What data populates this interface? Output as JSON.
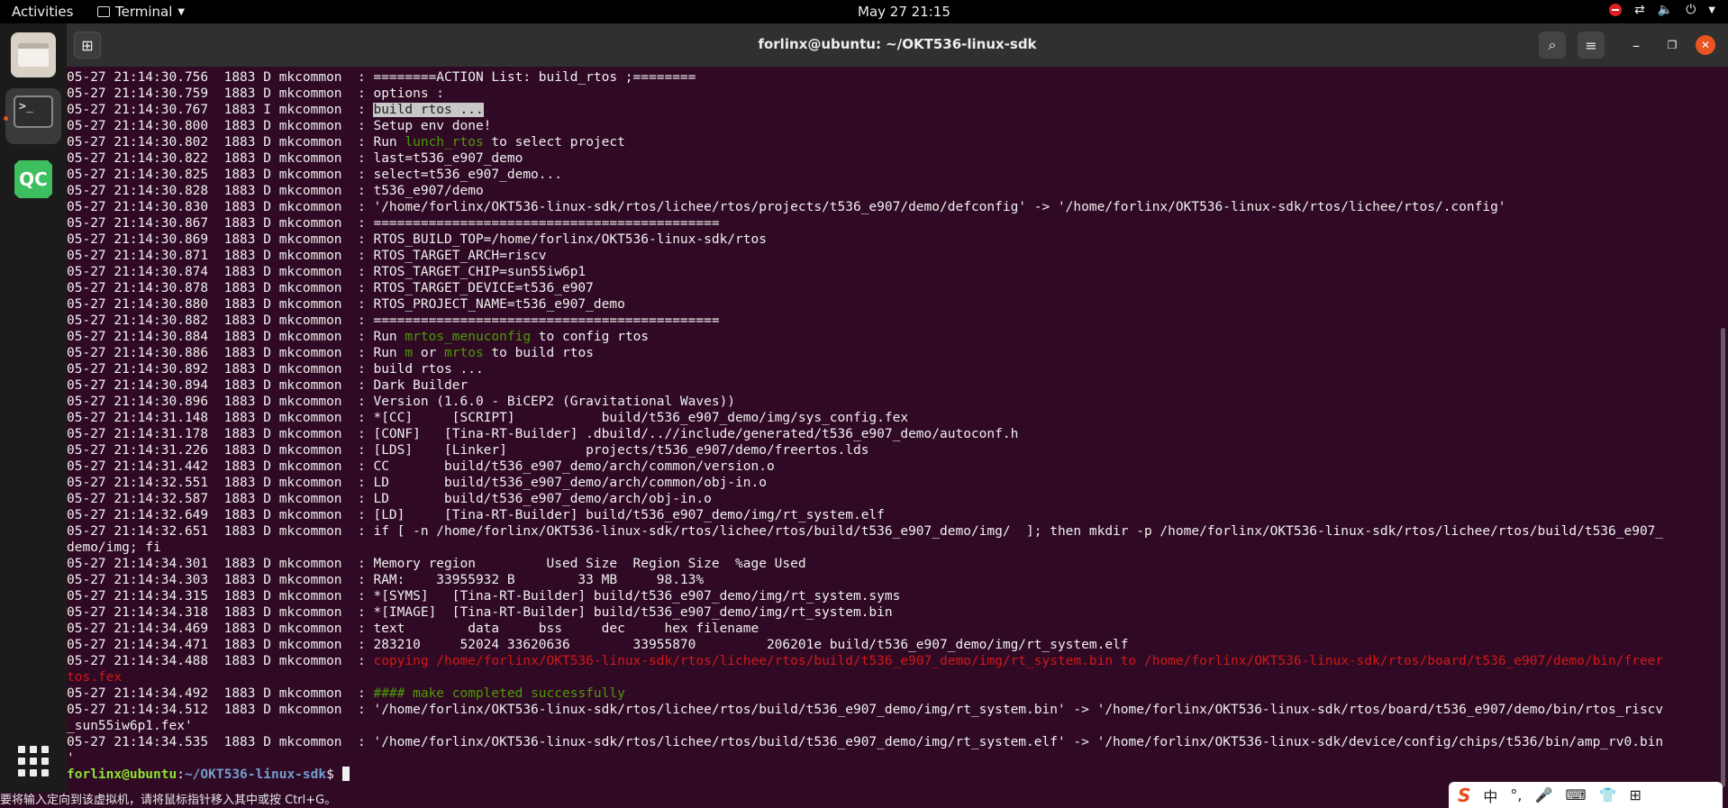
{
  "topbar": {
    "activities": "Activities",
    "app_name": "Terminal",
    "clock": "May 27  21:15"
  },
  "window": {
    "title": "forlinx@ubuntu: ~/OKT536-linux-sdk"
  },
  "terminal": {
    "lines": [
      [
        {
          "t": "05-27 21:14:30.756  1883 D mkcommon  : ========ACTION List: build_rtos ;========"
        }
      ],
      [
        {
          "t": "05-27 21:14:30.759  1883 D mkcommon  : options :"
        }
      ],
      [
        {
          "t": "05-27 21:14:30.767  1883 I mkcommon  : "
        },
        {
          "t": "build rtos ...",
          "c": "hl"
        }
      ],
      [
        {
          "t": "05-27 21:14:30.800  1883 D mkcommon  : Setup env done!"
        }
      ],
      [
        {
          "t": "05-27 21:14:30.802  1883 D mkcommon  : Run "
        },
        {
          "t": "lunch_rtos",
          "c": "grn"
        },
        {
          "t": " to select project"
        }
      ],
      [
        {
          "t": "05-27 21:14:30.822  1883 D mkcommon  : last=t536_e907_demo"
        }
      ],
      [
        {
          "t": "05-27 21:14:30.825  1883 D mkcommon  : select=t536_e907_demo..."
        }
      ],
      [
        {
          "t": "05-27 21:14:30.828  1883 D mkcommon  : t536_e907/demo"
        }
      ],
      [
        {
          "t": "05-27 21:14:30.830  1883 D mkcommon  : '/home/forlinx/OKT536-linux-sdk/rtos/lichee/rtos/projects/t536_e907/demo/defconfig' -> '/home/forlinx/OKT536-linux-sdk/rtos/lichee/rtos/.config'"
        }
      ],
      [
        {
          "t": "05-27 21:14:30.867  1883 D mkcommon  : ============================================"
        }
      ],
      [
        {
          "t": "05-27 21:14:30.869  1883 D mkcommon  : RTOS_BUILD_TOP=/home/forlinx/OKT536-linux-sdk/rtos"
        }
      ],
      [
        {
          "t": "05-27 21:14:30.871  1883 D mkcommon  : RTOS_TARGET_ARCH=riscv"
        }
      ],
      [
        {
          "t": "05-27 21:14:30.874  1883 D mkcommon  : RTOS_TARGET_CHIP=sun55iw6p1"
        }
      ],
      [
        {
          "t": "05-27 21:14:30.878  1883 D mkcommon  : RTOS_TARGET_DEVICE=t536_e907"
        }
      ],
      [
        {
          "t": "05-27 21:14:30.880  1883 D mkcommon  : RTOS_PROJECT_NAME=t536_e907_demo"
        }
      ],
      [
        {
          "t": "05-27 21:14:30.882  1883 D mkcommon  : ============================================"
        }
      ],
      [
        {
          "t": "05-27 21:14:30.884  1883 D mkcommon  : Run "
        },
        {
          "t": "mrtos_menuconfig",
          "c": "grn"
        },
        {
          "t": " to config rtos"
        }
      ],
      [
        {
          "t": "05-27 21:14:30.886  1883 D mkcommon  : Run "
        },
        {
          "t": "m",
          "c": "grn"
        },
        {
          "t": " or "
        },
        {
          "t": "mrtos",
          "c": "grn"
        },
        {
          "t": " to build rtos"
        }
      ],
      [
        {
          "t": "05-27 21:14:30.892  1883 D mkcommon  : build rtos ..."
        }
      ],
      [
        {
          "t": "05-27 21:14:30.894  1883 D mkcommon  : Dark Builder"
        }
      ],
      [
        {
          "t": "05-27 21:14:30.896  1883 D mkcommon  : Version (1.6.0 - BiCEP2 (Gravitational Waves))"
        }
      ],
      [
        {
          "t": "05-27 21:14:31.148  1883 D mkcommon  : *[CC]     [SCRIPT]           build/t536_e907_demo/img/sys_config.fex"
        }
      ],
      [
        {
          "t": "05-27 21:14:31.178  1883 D mkcommon  : [CONF]   [Tina-RT-Builder] .dbuild/..//include/generated/t536_e907_demo/autoconf.h"
        }
      ],
      [
        {
          "t": "05-27 21:14:31.226  1883 D mkcommon  : [LDS]    [Linker]          projects/t536_e907/demo/freertos.lds"
        }
      ],
      [
        {
          "t": "05-27 21:14:31.442  1883 D mkcommon  : CC       build/t536_e907_demo/arch/common/version.o"
        }
      ],
      [
        {
          "t": "05-27 21:14:32.551  1883 D mkcommon  : LD       build/t536_e907_demo/arch/common/obj-in.o"
        }
      ],
      [
        {
          "t": "05-27 21:14:32.587  1883 D mkcommon  : LD       build/t536_e907_demo/arch/obj-in.o"
        }
      ],
      [
        {
          "t": "05-27 21:14:32.649  1883 D mkcommon  : [LD]     [Tina-RT-Builder] build/t536_e907_demo/img/rt_system.elf"
        }
      ],
      [
        {
          "t": "05-27 21:14:32.651  1883 D mkcommon  : if [ -n /home/forlinx/OKT536-linux-sdk/rtos/lichee/rtos/build/t536_e907_demo/img/  ]; then mkdir -p /home/forlinx/OKT536-linux-sdk/rtos/lichee/rtos/build/t536_e907_"
        }
      ],
      [
        {
          "t": "demo/img; fi"
        }
      ],
      [
        {
          "t": "05-27 21:14:34.301  1883 D mkcommon  : Memory region         Used Size  Region Size  %age Used"
        }
      ],
      [
        {
          "t": "05-27 21:14:34.303  1883 D mkcommon  : RAM:    33955932 B        33 MB     98.13%"
        }
      ],
      [
        {
          "t": "05-27 21:14:34.315  1883 D mkcommon  : *[SYMS]   [Tina-RT-Builder] build/t536_e907_demo/img/rt_system.syms"
        }
      ],
      [
        {
          "t": "05-27 21:14:34.318  1883 D mkcommon  : *[IMAGE]  [Tina-RT-Builder] build/t536_e907_demo/img/rt_system.bin"
        }
      ],
      [
        {
          "t": "05-27 21:14:34.469  1883 D mkcommon  : text        data     bss     dec     hex filename"
        }
      ],
      [
        {
          "t": "05-27 21:14:34.471  1883 D mkcommon  : 283210     52024 33620636        33955870         206201e build/t536_e907_demo/img/rt_system.elf"
        }
      ],
      [
        {
          "t": "05-27 21:14:34.488  1883 D mkcommon  : "
        },
        {
          "t": "copying /home/forlinx/OKT536-linux-sdk/rtos/lichee/rtos/build/t536_e907_demo/img/rt_system.bin to /home/forlinx/OKT536-linux-sdk/rtos/board/t536_e907/demo/bin/freer",
          "c": "red"
        }
      ],
      [
        {
          "t": "tos.fex",
          "c": "red"
        }
      ],
      [
        {
          "t": "05-27 21:14:34.492  1883 D mkcommon  : "
        },
        {
          "t": "#### make completed successfully",
          "c": "grn"
        }
      ],
      [
        {
          "t": "05-27 21:14:34.512  1883 D mkcommon  : '/home/forlinx/OKT536-linux-sdk/rtos/lichee/rtos/build/t536_e907_demo/img/rt_system.bin' -> '/home/forlinx/OKT536-linux-sdk/rtos/board/t536_e907/demo/bin/rtos_riscv"
        }
      ],
      [
        {
          "t": "_sun55iw6p1.fex'"
        }
      ],
      [
        {
          "t": "05-27 21:14:34.535  1883 D mkcommon  : '/home/forlinx/OKT536-linux-sdk/rtos/lichee/rtos/build/t536_e907_demo/img/rt_system.elf' -> '/home/forlinx/OKT536-linux-sdk/device/config/chips/t536/bin/amp_rv0.bin"
        }
      ],
      [
        {
          "t": "'"
        }
      ]
    ],
    "prompt_user": "forlinx@ubuntu",
    "prompt_sep": ":",
    "prompt_path": "~/OKT536-linux-sdk",
    "prompt_suffix": "$ "
  },
  "notice": {
    "text": "要将输入定向到该虚拟机，请将鼠标指针移入其中或按 Ctrl+G。"
  },
  "ime": {
    "mode": "中",
    "punct": "°,"
  },
  "icons": [
    "folder-icon",
    "terminal-icon",
    "qt-creator-icon",
    "app-grid-icon",
    "search-icon",
    "menu-icon",
    "close-icon",
    "network-icon",
    "volume-icon",
    "power-icon"
  ]
}
